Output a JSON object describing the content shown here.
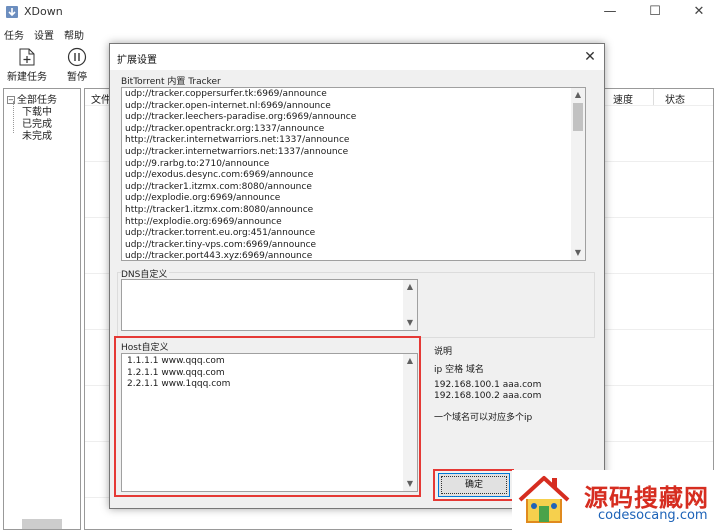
{
  "window": {
    "title": "XDown"
  },
  "window_controls": {
    "minimize": "—",
    "maximize": "☐",
    "close": "✕"
  },
  "menu": {
    "items": [
      "任务",
      "设置",
      "帮助"
    ]
  },
  "toolbar": {
    "new_task": "新建任务",
    "pause": "暂停"
  },
  "tree": {
    "root": "全部任务",
    "children": [
      "下载中",
      "已完成",
      "未完成"
    ]
  },
  "list": {
    "columns": [
      "文件",
      "速度",
      "状态"
    ]
  },
  "dialog": {
    "title": "扩展设置",
    "close": "✕",
    "tracker": {
      "label": "BitTorrent 内置 Tracker",
      "lines": [
        "udp://tracker.coppersurfer.tk:6969/announce",
        "udp://tracker.open-internet.nl:6969/announce",
        "udp://tracker.leechers-paradise.org:6969/announce",
        "udp://tracker.opentrackr.org:1337/announce",
        "http://tracker.internetwarriors.net:1337/announce",
        "udp://tracker.internetwarriors.net:1337/announce",
        "udp://9.rarbg.to:2710/announce",
        "udp://exodus.desync.com:6969/announce",
        "udp://tracker1.itzmx.com:8080/announce",
        "udp://explodie.org:6969/announce",
        "http://tracker1.itzmx.com:8080/announce",
        "http://explodie.org:6969/announce",
        "udp://tracker.torrent.eu.org:451/announce",
        "udp://tracker.tiny-vps.com:6969/announce",
        "udp://tracker.port443.xyz:6969/announce"
      ]
    },
    "dns": {
      "label": "DNS自定义",
      "value": ""
    },
    "host": {
      "label": "Host自定义",
      "lines": [
        "1.1.1.1 www.qqq.com",
        "1.2.1.1 www.qqq.com",
        "2.2.1.1 www.1qqq.com"
      ]
    },
    "help": {
      "title": "说明",
      "format": "ip 空格 域名",
      "example1": "192.168.100.1  aaa.com",
      "example2": "192.168.100.2  aaa.com",
      "note": "一个域名可以对应多个ip"
    },
    "ok_label": "确定"
  },
  "watermark": {
    "cn": "源码搜藏网",
    "en": "codesocang.com"
  },
  "colors": {
    "highlight": "#e53935",
    "accent": "#0078d7",
    "dialog_bg": "#f0f0f0"
  }
}
